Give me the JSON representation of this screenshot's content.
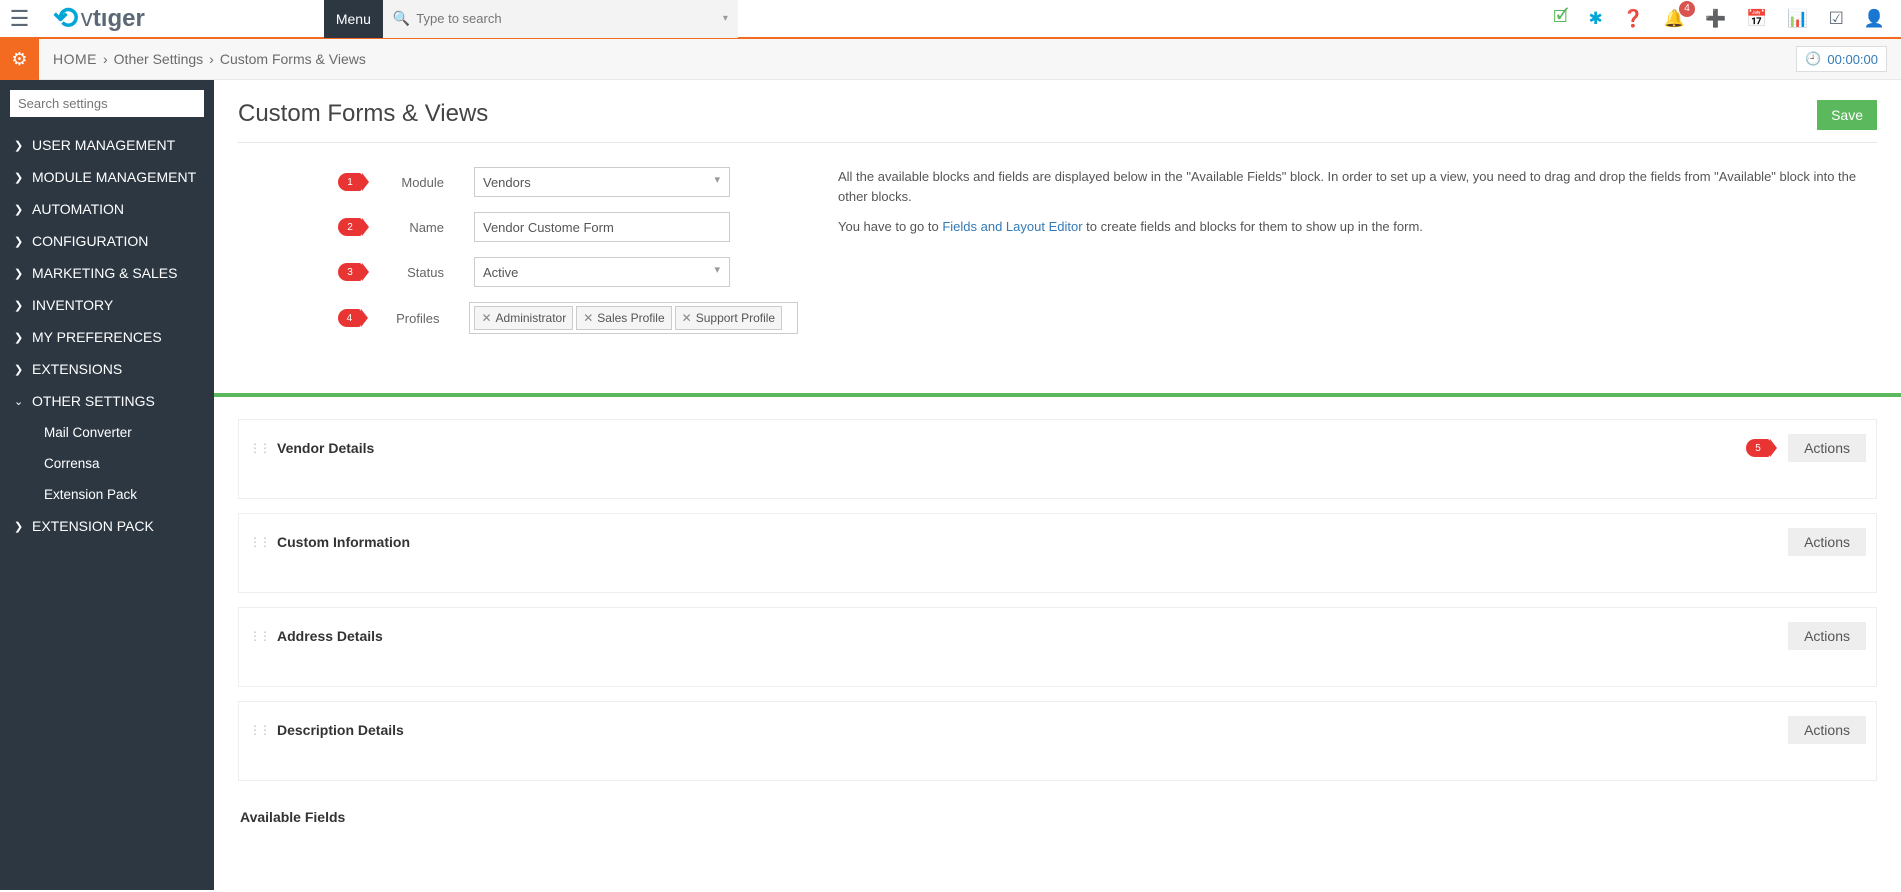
{
  "top": {
    "menu_label": "Menu",
    "search_placeholder": "Type to search",
    "notification_count": "4"
  },
  "timer": "00:00:00",
  "breadcrumb": {
    "home": "HOME",
    "level1": "Other Settings",
    "level2": "Custom Forms & Views"
  },
  "sidebar": {
    "search_placeholder": "Search settings",
    "items": [
      "USER MANAGEMENT",
      "MODULE MANAGEMENT",
      "AUTOMATION",
      "CONFIGURATION",
      "MARKETING & SALES",
      "INVENTORY",
      "MY PREFERENCES",
      "EXTENSIONS",
      "OTHER SETTINGS",
      "EXTENSION PACK"
    ],
    "other_settings_children": [
      "Mail Converter",
      "Corrensa",
      "Extension Pack"
    ]
  },
  "page": {
    "title": "Custom Forms & Views",
    "save_label": "Save",
    "form": {
      "module": {
        "label": "Module",
        "value": "Vendors",
        "callout": "1"
      },
      "name": {
        "label": "Name",
        "value": "Vendor Custome Form",
        "callout": "2"
      },
      "status": {
        "label": "Status",
        "value": "Active",
        "callout": "3"
      },
      "profiles": {
        "label": "Profiles",
        "callout": "4",
        "tags": [
          "Administrator",
          "Sales Profile",
          "Support Profile"
        ]
      }
    },
    "help": {
      "p1": "All the available blocks and fields are displayed below in the \"Available Fields\" block. In order to set up a view, you need to drag and drop the fields from \"Available\" block into the other blocks.",
      "p2a": "You have to go to ",
      "p2_link": "Fields and Layout Editor",
      "p2b": " to create fields and blocks for them to show up in the form."
    },
    "blocks": [
      {
        "title": "Vendor Details",
        "callout": "5"
      },
      {
        "title": "Custom Information"
      },
      {
        "title": "Address Details"
      },
      {
        "title": "Description Details"
      }
    ],
    "actions_label": "Actions",
    "available_fields_label": "Available Fields"
  }
}
